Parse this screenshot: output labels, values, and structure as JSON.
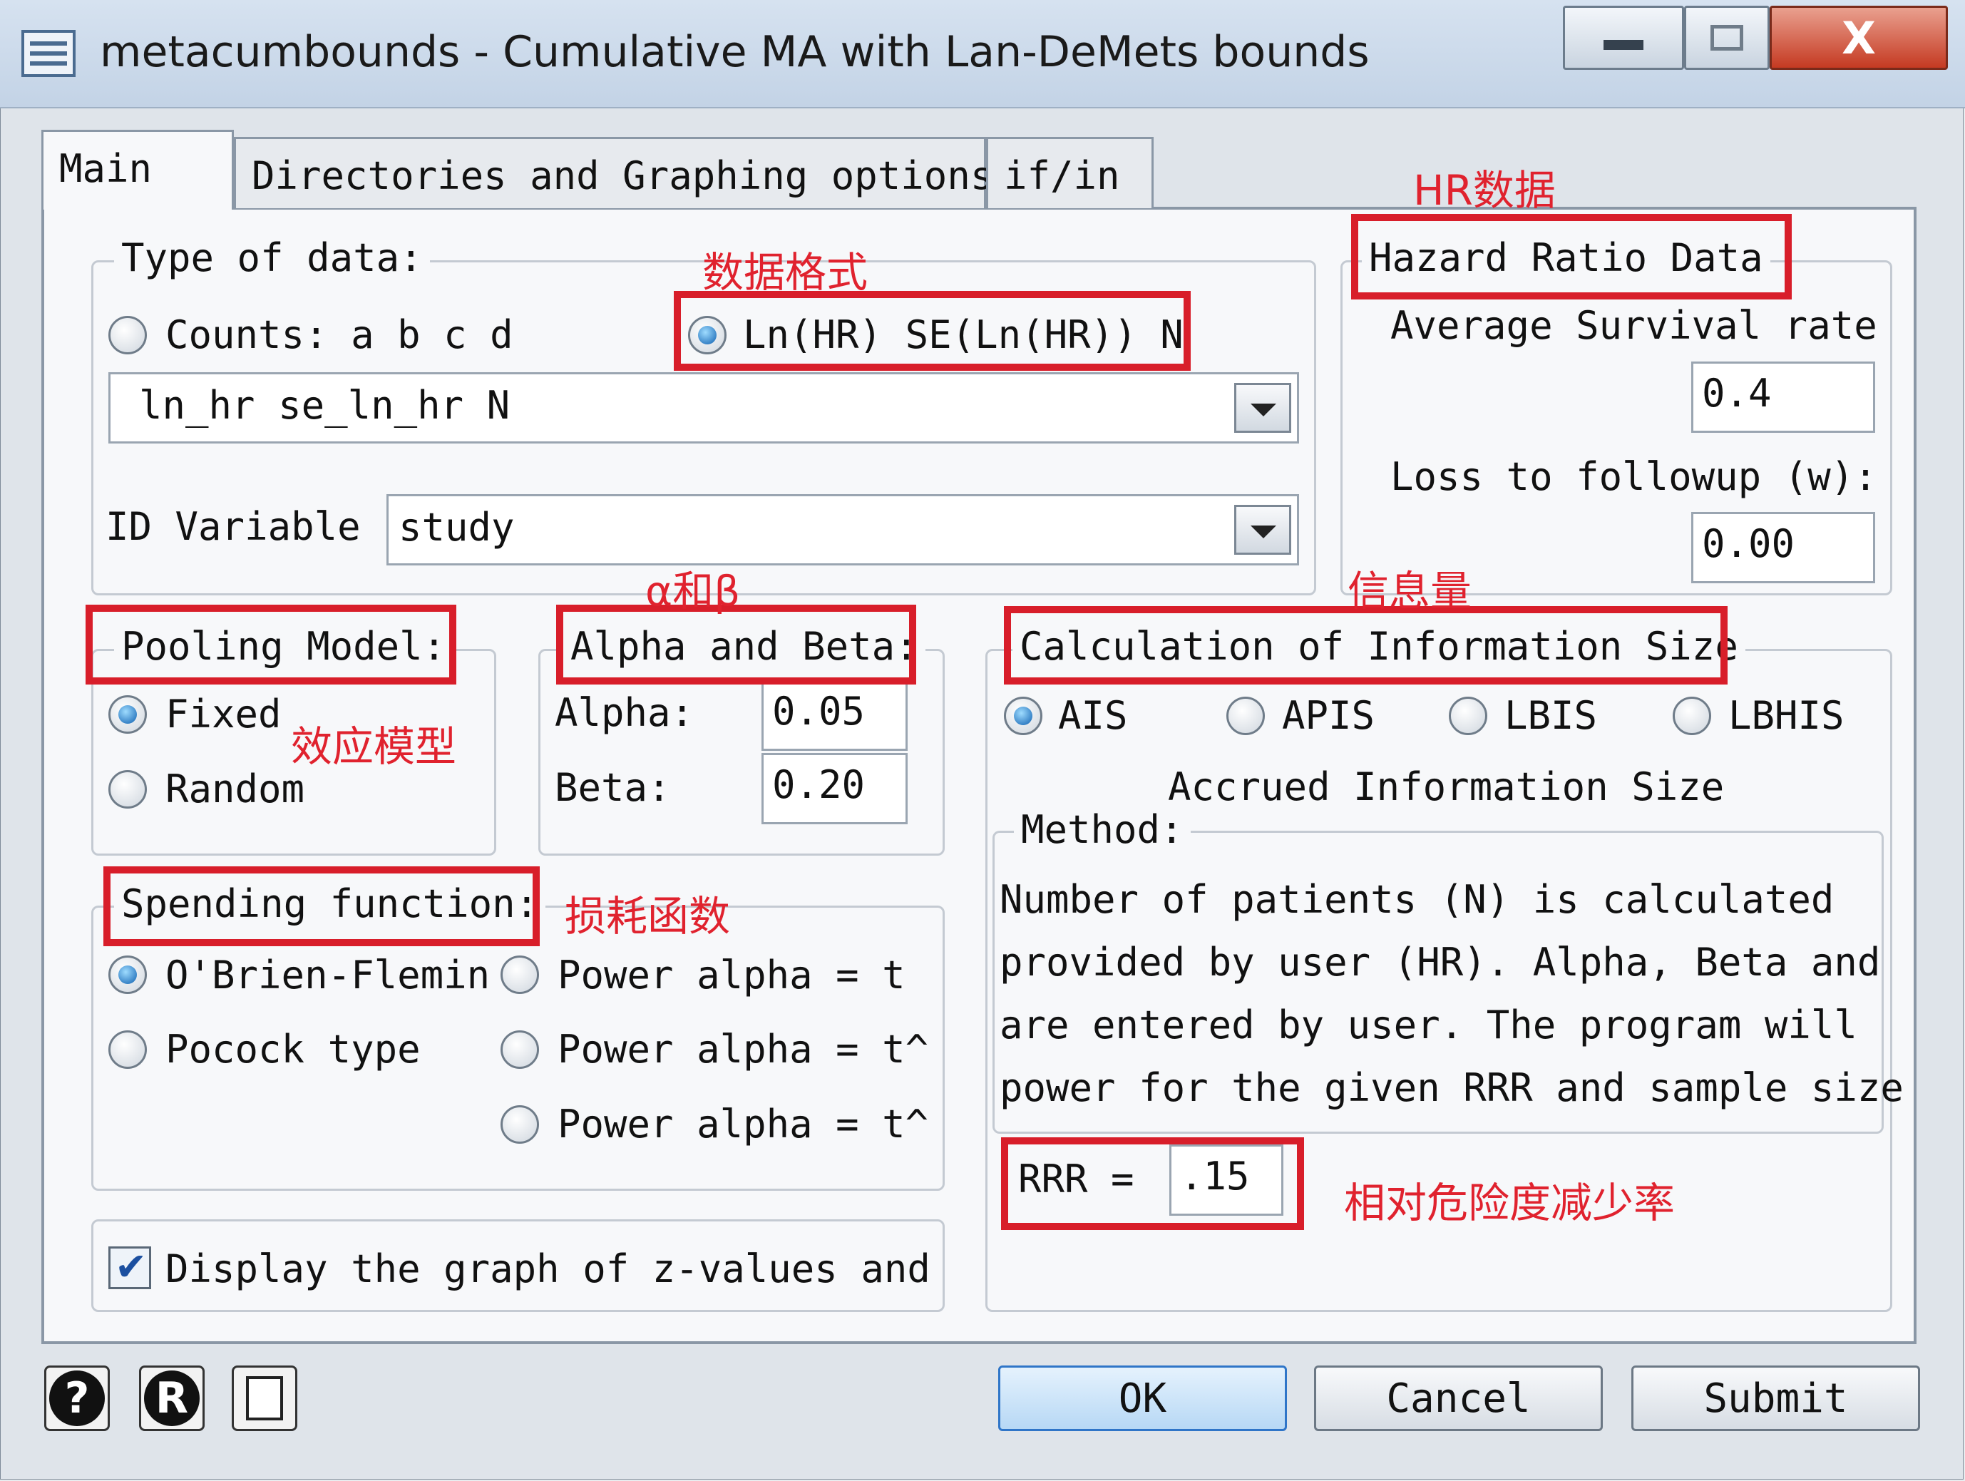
{
  "window": {
    "title": "metacumbounds - Cumulative MA with Lan-DeMets bounds",
    "close_glyph": "X"
  },
  "tabs": [
    "Main",
    "Directories and Graphing options",
    "if/in"
  ],
  "type_of_data": {
    "label": "Type of data:",
    "option_counts": "Counts: a b c d",
    "option_lnhr": "Ln(HR) SE(Ln(HR)) N",
    "selected": "Ln(HR) SE(Ln(HR)) N",
    "variables_value": "ln_hr se_ln_hr N",
    "id_label": "ID Variable",
    "id_value": "study"
  },
  "hazard_ratio": {
    "label": "Hazard Ratio Data",
    "survival_label": "Average Survival rate",
    "survival_value": "0.4",
    "loss_label": "Loss to followup (w):",
    "loss_value": "0.00"
  },
  "pooling": {
    "label": "Pooling Model:",
    "fixed": "Fixed",
    "random": "Random",
    "selected": "Fixed"
  },
  "alpha_beta": {
    "label": "Alpha and Beta:",
    "alpha_label": "Alpha:",
    "alpha_value": "0.05",
    "beta_label": "Beta:",
    "beta_value": "0.20"
  },
  "information_size": {
    "label": "Calculation of Information Size",
    "options": [
      "AIS",
      "APIS",
      "LBIS",
      "LBHIS"
    ],
    "selected": "AIS",
    "caption": "Accrued Information Size",
    "method_label": "Method:",
    "method_lines": [
      "Number of patients (N) is calculated",
      "provided by user (HR). Alpha, Beta and",
      "are entered by user. The program will",
      "power for the given RRR and sample size"
    ],
    "rrr_label": "RRR =",
    "rrr_value": ".15"
  },
  "spending": {
    "label": "Spending function:",
    "obrien": "O'Brien-Flemin",
    "pocock": "Pocock type",
    "power1": "Power alpha = t",
    "power2": "Power alpha = t^",
    "power3": "Power alpha = t^",
    "selected": "O'Brien-Flemin"
  },
  "display_graph": {
    "label": "Display the graph of z-values and",
    "checked": true
  },
  "buttons": {
    "ok": "OK",
    "cancel": "Cancel",
    "submit": "Submit"
  },
  "annotations": {
    "hr_data": "HR数据",
    "data_format": "数据格式",
    "alpha_beta": "α和β",
    "information": "信息量",
    "effect_model": "效应模型",
    "spending": "损耗函数",
    "rrr": "相对危险度减少率"
  },
  "colors": {
    "annotation_red": "#d81e2a",
    "radio_selected": "#0d5fb0",
    "ok_border": "#2f75c8"
  },
  "icons": [
    "help-icon",
    "r-info-icon",
    "copy-icon",
    "app-icon"
  ]
}
